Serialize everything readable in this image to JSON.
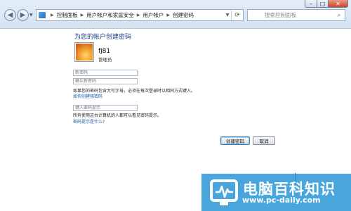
{
  "window": {
    "minimize_glyph": "–",
    "maximize_glyph": "□",
    "close_glyph": "✕"
  },
  "nav": {
    "back_glyph": "◀",
    "forward_glyph": "▶",
    "dropdown_glyph": "▼"
  },
  "address": {
    "breadcrumbs": [
      "控制面板",
      "用户帐户和家庭安全",
      "用户帐户",
      "创建密码"
    ],
    "separator": "▶",
    "refresh_glyph": "⟳"
  },
  "search": {
    "placeholder": "搜索控制面板",
    "icon": "search-icon"
  },
  "main": {
    "heading": "为您的帐户创建密码",
    "user": {
      "name": "fj81",
      "role": "管理员"
    },
    "fields": {
      "new_password_placeholder": "新密码",
      "confirm_password_placeholder": "确认新密码",
      "hint_placeholder": "键入密码提示"
    },
    "notes": {
      "case_note": "如果您的密码包含大写字母，必须在每次登录时以相同方式键入。",
      "strong_link": "如何创建强密码",
      "hint_note": "所有使用这台计算机的人都可以看见密码提示。",
      "hint_link": "密码提示是什么?"
    },
    "buttons": {
      "create": "创建密码",
      "cancel": "取消"
    }
  },
  "watermark": {
    "title": "电脑百科知识",
    "url": "www.pc-daily.com",
    "color": "#2896d7"
  }
}
